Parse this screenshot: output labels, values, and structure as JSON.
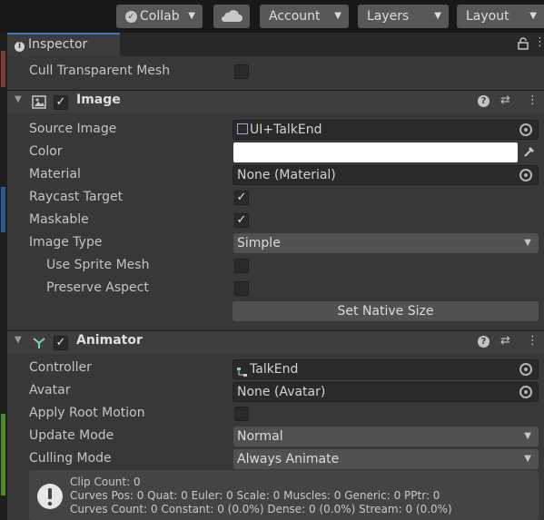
{
  "toolbar": {
    "collab": "Collab",
    "account": "Account",
    "layers": "Layers",
    "layout": "Layout"
  },
  "tab": {
    "label": "Inspector"
  },
  "cull_row": {
    "label": "Cull Transparent Mesh"
  },
  "image_component": {
    "title": "Image",
    "source_image": {
      "label": "Source Image",
      "value": "UI+TalkEnd"
    },
    "color": {
      "label": "Color",
      "value": "#ffffff"
    },
    "material": {
      "label": "Material",
      "value": "None (Material)"
    },
    "raycast_target": {
      "label": "Raycast Target",
      "checked": true
    },
    "maskable": {
      "label": "Maskable",
      "checked": true
    },
    "image_type": {
      "label": "Image Type",
      "value": "Simple"
    },
    "use_sprite_mesh": {
      "label": "Use Sprite Mesh",
      "checked": false
    },
    "preserve_aspect": {
      "label": "Preserve Aspect",
      "checked": false
    },
    "set_native_size": "Set Native Size"
  },
  "animator_component": {
    "title": "Animator",
    "controller": {
      "label": "Controller",
      "value": "TalkEnd"
    },
    "avatar": {
      "label": "Avatar",
      "value": "None (Avatar)"
    },
    "apply_root_motion": {
      "label": "Apply Root Motion",
      "checked": false
    },
    "update_mode": {
      "label": "Update Mode",
      "value": "Normal"
    },
    "culling_mode": {
      "label": "Culling Mode",
      "value": "Always Animate"
    }
  },
  "info": {
    "line1": "Clip Count: 0",
    "line2": "Curves Pos: 0 Quat: 0 Euler: 0 Scale: 0 Muscles: 0 Generic: 0 PPtr: 0",
    "line3": "Curves Count: 0 Constant: 0 (0.0%) Dense: 0 (0.0%) Stream: 0 (0.0%)"
  },
  "icons": [
    "cloud-icon",
    "info-icon",
    "lock-icon",
    "menu-icon",
    "image-component-icon",
    "animator-component-icon",
    "help-icon",
    "presets-icon",
    "object-picker-icon",
    "eyedropper-icon",
    "sprite-asset-icon",
    "controller-asset-icon",
    "warning-icon"
  ]
}
